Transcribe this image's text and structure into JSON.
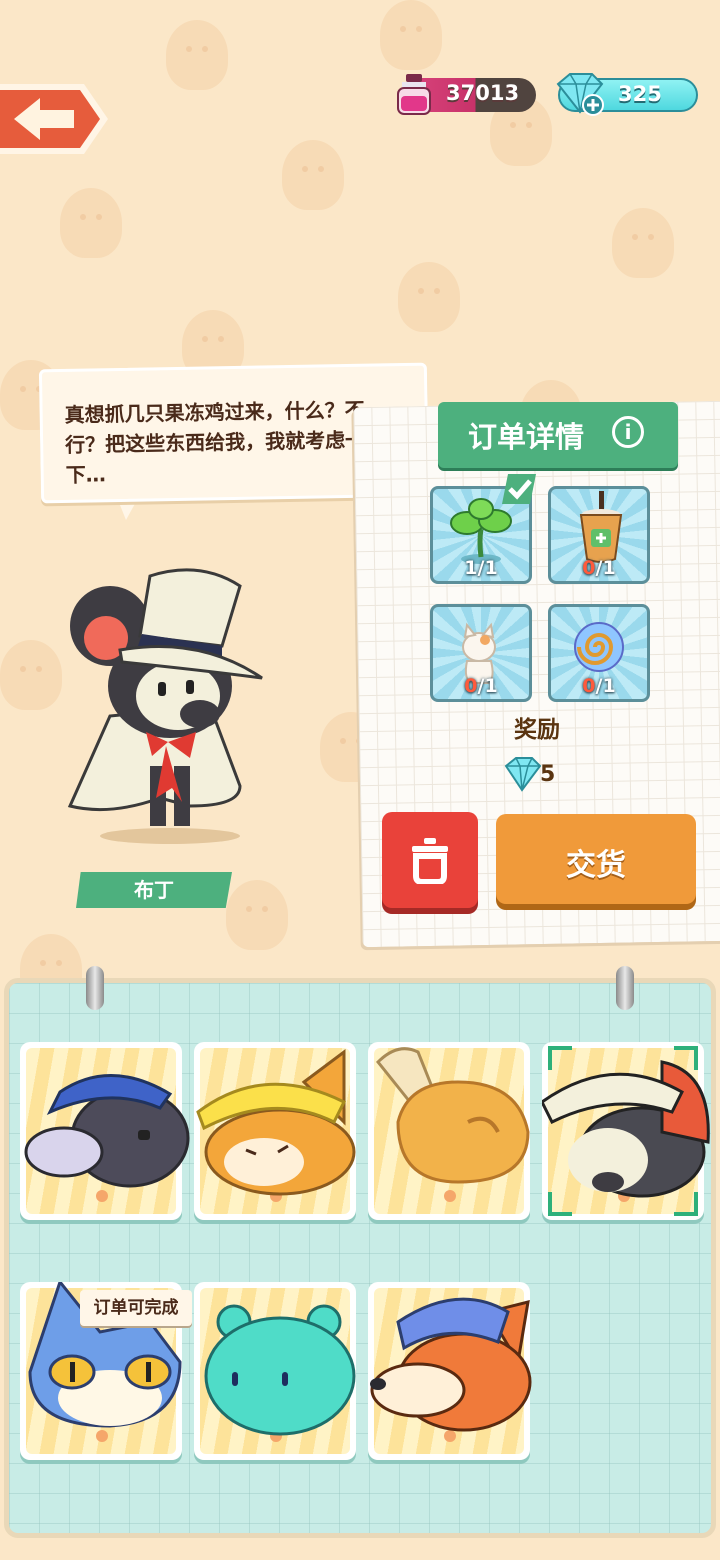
{
  "resources": {
    "ink_value": "37013",
    "gem_value": "325"
  },
  "npc": {
    "speech": "真想抓几只果冻鸡过来，什么？不行？把这些东西给我，我就考虑一下…",
    "name": "布丁"
  },
  "order": {
    "title": "订单详情",
    "items": [
      {
        "icon": "clover-sprout-icon",
        "have": "1",
        "need": "1",
        "completed": true
      },
      {
        "icon": "bubble-tea-icon",
        "have": "0",
        "need": "1",
        "completed": false
      },
      {
        "icon": "cat-figurine-icon",
        "have": "0",
        "need": "1",
        "completed": false
      },
      {
        "icon": "swirl-orb-icon",
        "have": "0",
        "need": "1",
        "completed": false
      }
    ],
    "reward_label": "奖励",
    "reward_amount": "5",
    "deliver_label": "交货"
  },
  "cards": [
    {
      "name": "gray-donkey-blue-cap"
    },
    {
      "name": "shiba-yellow-hat"
    },
    {
      "name": "roast-chicken"
    },
    {
      "name": "mouse-top-hat",
      "selected": true
    },
    {
      "name": "blue-cat",
      "tag": "订单可完成"
    },
    {
      "name": "teal-bear"
    },
    {
      "name": "orange-fox-blue-cap"
    }
  ],
  "colors": {
    "background": "#fbe7c8",
    "accent_green": "#4db07e",
    "delete_red": "#e9423a",
    "deliver_orange": "#f09a3a",
    "notebook_teal": "#c8ece6"
  }
}
